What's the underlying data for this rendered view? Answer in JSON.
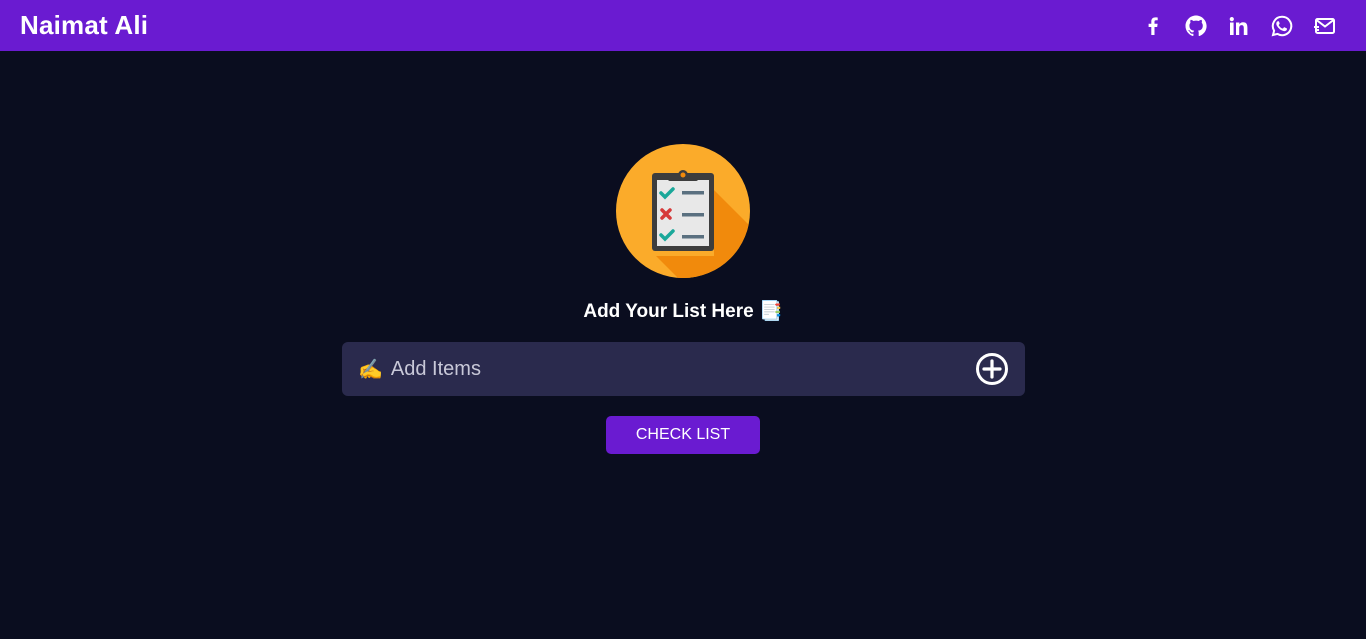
{
  "navbar": {
    "brand": "Naimat Ali",
    "background": "#6a1bd1",
    "socials": [
      {
        "icon": "facebook-icon"
      },
      {
        "icon": "github-icon"
      },
      {
        "icon": "linkedin-icon"
      },
      {
        "icon": "whatsapp-icon"
      },
      {
        "icon": "mail-icon"
      }
    ]
  },
  "main": {
    "background": "#0a0d1f",
    "logo_icon": "checklist-clipboard-icon",
    "heading": "Add Your List Here",
    "heading_emoji": "📑",
    "input": {
      "emoji": "✍️",
      "placeholder": "Add Items",
      "value": ""
    },
    "add_icon": "plus-circle-icon",
    "check_button_label": "CHECK LIST"
  }
}
